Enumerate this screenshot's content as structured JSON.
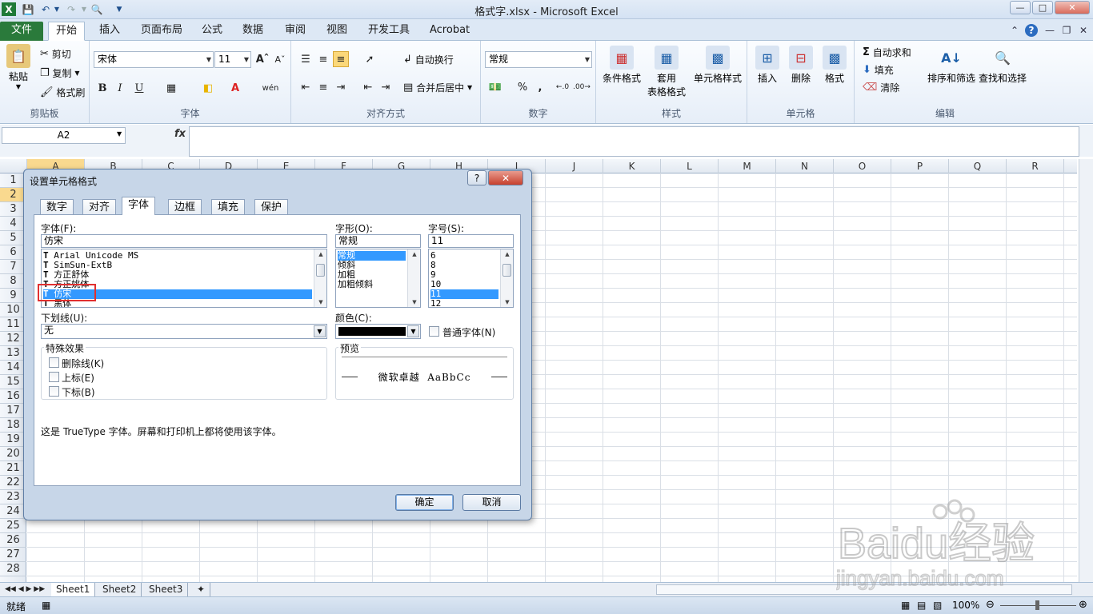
{
  "window": {
    "title": "格式字.xlsx - Microsoft Excel",
    "qat_icons": [
      "excel-logo-icon",
      "save-icon",
      "undo-icon",
      "redo-icon",
      "print-preview-icon",
      "customize-icon"
    ]
  },
  "tabs": [
    "文件",
    "开始",
    "插入",
    "页面布局",
    "公式",
    "数据",
    "审阅",
    "视图",
    "开发工具",
    "Acrobat"
  ],
  "active_tab": "开始",
  "ribbon": {
    "clipboard": {
      "name": "剪贴板",
      "paste": "粘贴",
      "cut": "剪切",
      "copy": "复制",
      "format_painter": "格式刷"
    },
    "font": {
      "name": "字体",
      "font_value": "宋体",
      "size_value": "11"
    },
    "align": {
      "name": "对齐方式",
      "wrap": "自动换行",
      "merge": "合并后居中"
    },
    "number": {
      "name": "数字",
      "format_value": "常规",
      "percent": "%",
      "comma": ","
    },
    "styles": {
      "name": "样式",
      "cond": "条件格式",
      "table_line1": "套用",
      "table_line2": "表格格式",
      "cellstyle": "单元格样式"
    },
    "cells": {
      "name": "单元格",
      "insert": "插入",
      "delete": "删除",
      "format": "格式"
    },
    "editing": {
      "name": "编辑",
      "autosum": "自动求和",
      "fill": "填充",
      "clear": "清除",
      "sort": "排序和筛选",
      "find": "查找和选择"
    }
  },
  "formula": {
    "namebox": "A2",
    "fx": "fx",
    "value": ""
  },
  "columns": [
    "A",
    "B",
    "C",
    "D",
    "E",
    "F",
    "G",
    "H",
    "I",
    "J",
    "K",
    "L",
    "M",
    "N",
    "O",
    "P",
    "Q",
    "R"
  ],
  "rows": [
    "1",
    "2",
    "3",
    "4",
    "5",
    "6",
    "7",
    "8",
    "9",
    "10",
    "11",
    "12",
    "13",
    "14",
    "15",
    "16",
    "17",
    "18",
    "19",
    "20",
    "21",
    "22",
    "23",
    "24",
    "25",
    "26",
    "27",
    "28"
  ],
  "sheets": [
    "Sheet1",
    "Sheet2",
    "Sheet3"
  ],
  "status": {
    "ready": "就绪",
    "zoom": "100%"
  },
  "dialog": {
    "title": "设置单元格格式",
    "help": "?",
    "tabs": [
      "数字",
      "对齐",
      "字体",
      "边框",
      "填充",
      "保护"
    ],
    "active_tab": "字体",
    "font_label": "字体(F):",
    "font_value": "仿宋",
    "font_list": [
      "Arial Unicode MS",
      "SimSun-ExtB",
      "方正舒体",
      "方正姚体",
      "仿宋",
      "黑体"
    ],
    "font_selected": "仿宋",
    "style_label": "字形(O):",
    "style_value": "常规",
    "style_list": [
      "常规",
      "倾斜",
      "加粗",
      "加粗倾斜"
    ],
    "style_selected": "常规",
    "size_label": "字号(S):",
    "size_value": "11",
    "size_list": [
      "6",
      "8",
      "9",
      "10",
      "11",
      "12"
    ],
    "size_selected": "11",
    "underline_label": "下划线(U):",
    "underline_value": "无",
    "color_label": "颜色(C):",
    "color_value": "#000000",
    "normal_font": "普通字体(N)",
    "effects_label": "特殊效果",
    "strike": "删除线(K)",
    "superscript": "上标(E)",
    "subscript": "下标(B)",
    "preview_label": "预览",
    "preview_text": "微软卓越  AaBbCc",
    "note": "这是 TrueType 字体。屏幕和打印机上都将使用该字体。",
    "ok": "确定",
    "cancel": "取消"
  },
  "watermark": {
    "brand": "Baidu经验",
    "url": "jingyan.baidu.com"
  },
  "colors": {
    "file_tab": "#2a7a3b",
    "selection": "#3399ff",
    "highlight": "#e13030"
  }
}
